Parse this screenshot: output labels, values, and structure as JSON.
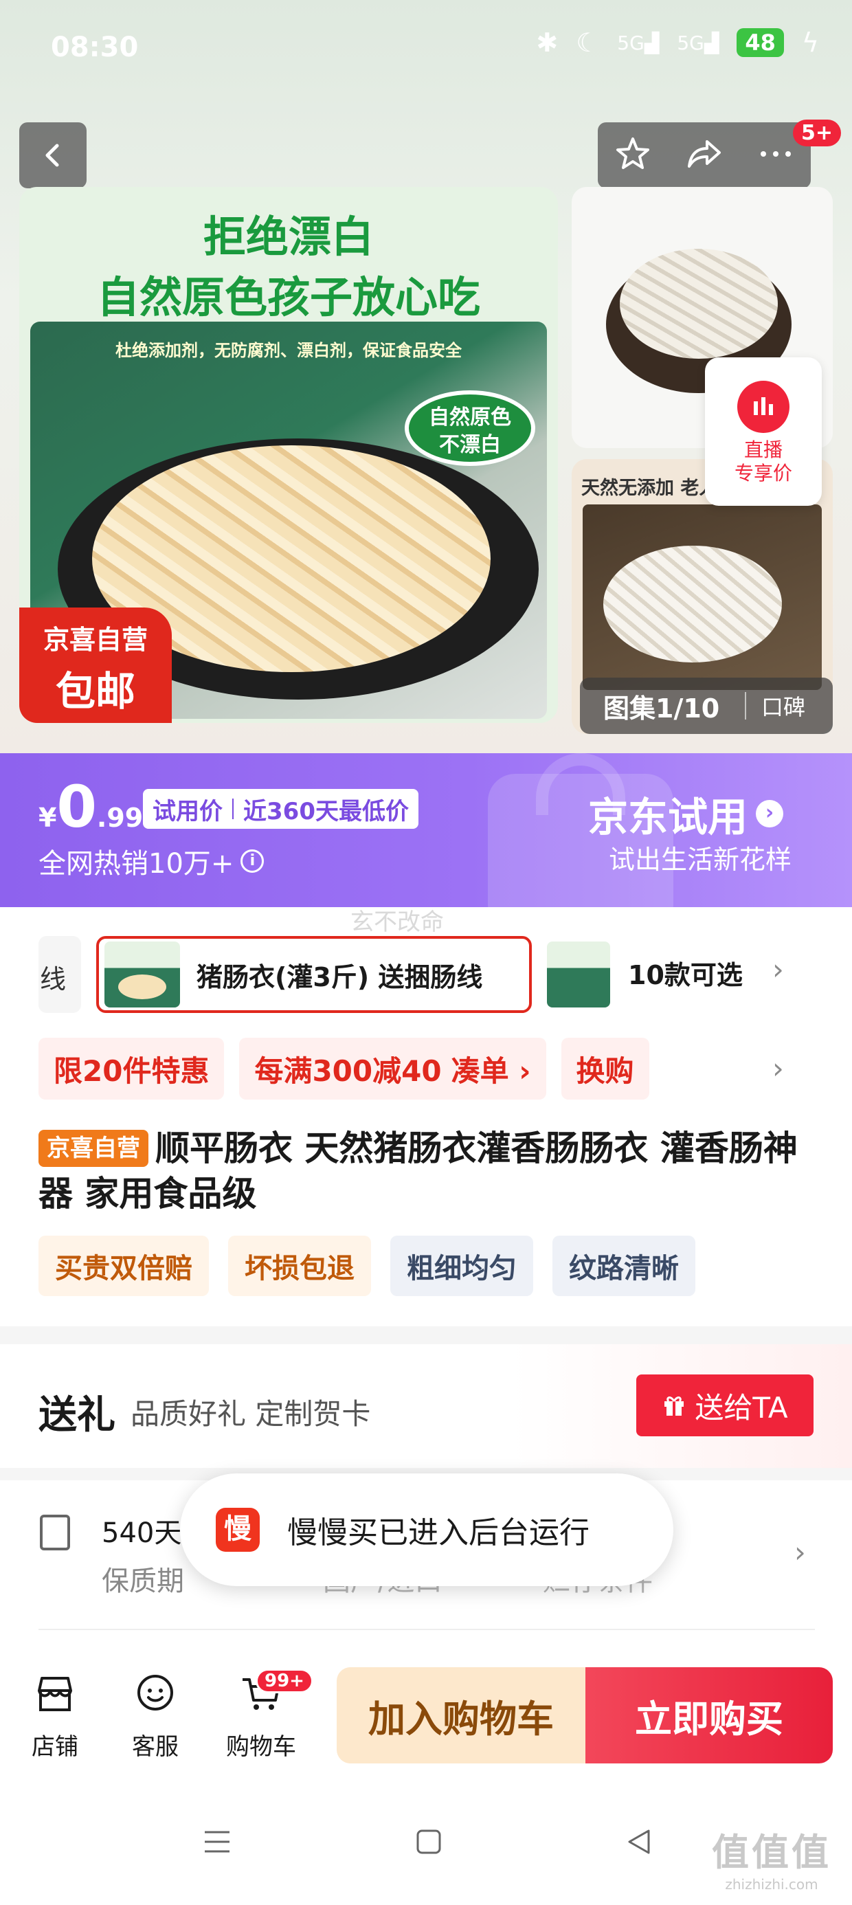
{
  "status_bar": {
    "time": "08:30",
    "battery": "48",
    "signal_1": "5G",
    "signal_2": "5G"
  },
  "header": {
    "message_badge": "5+"
  },
  "gallery": {
    "main_heading_1": "拒绝漂白",
    "main_heading_2": "自然原色孩子放心吃",
    "photo_caption": "杜绝添加剂，无防腐剂、漂白剂，保证食品安全",
    "bubble_line_1": "自然原色",
    "bubble_line_2": "不漂白",
    "jx_tag_line_1": "京喜自营",
    "jx_tag_line_2": "包邮",
    "side_text": "天然无添加 老人孩子放心吃",
    "live_line_1": "直播",
    "live_line_2": "专享价",
    "counter": "图集1/10",
    "review": "口碑"
  },
  "price_banner": {
    "currency": "¥",
    "price_int": "0",
    "price_dec": ".99",
    "tag_1": "试用价",
    "tag_2": "近360天最低价",
    "hot_sale": "全网热销10万+",
    "trial_title": "京东试用",
    "trial_sub": "试出生活新花样",
    "watermark": "玄不改命"
  },
  "sku": {
    "prev_partial": "线",
    "selected": "猪肠衣(灌3斤) 送捆肠线",
    "more": "10款可选"
  },
  "promotions": {
    "items": [
      {
        "label": "限20件特惠",
        "sub": ""
      },
      {
        "label": "每满300减40",
        "sub": "凑单 ›"
      },
      {
        "label": "换购",
        "sub": ""
      }
    ]
  },
  "product": {
    "badge": "京喜自营",
    "title": "顺平肠衣 天然猪肠衣灌香肠肠衣 灌香肠神器 家用食品级",
    "tags": [
      "买贵双倍赔",
      "坏损包退",
      "粗细均匀",
      "纹路清晰"
    ]
  },
  "gift": {
    "title": "送礼",
    "subtitle": "品质好礼 定制贺卡",
    "button": "送给TA"
  },
  "specs": {
    "shelf_life_value": "540天",
    "shelf_life_label": "保质期",
    "col2_label": "国产/进口",
    "col3_label": "贮存条件"
  },
  "toast": {
    "icon_text": "慢",
    "message": "慢慢买已进入后台运行"
  },
  "bottom_bar": {
    "store": "店铺",
    "service": "客服",
    "cart": "购物车",
    "cart_badge": "99+",
    "add_to_cart": "加入购物车",
    "buy_now": "立即购买"
  },
  "watermark_bottom": {
    "big": "值值值",
    "small": "zhizhizhi.com"
  },
  "colors": {
    "brand_red": "#f0243a",
    "trial_purple": "#9c72f5",
    "jx_orange": "#f07a1a",
    "green_heading": "#1a9a3e"
  }
}
